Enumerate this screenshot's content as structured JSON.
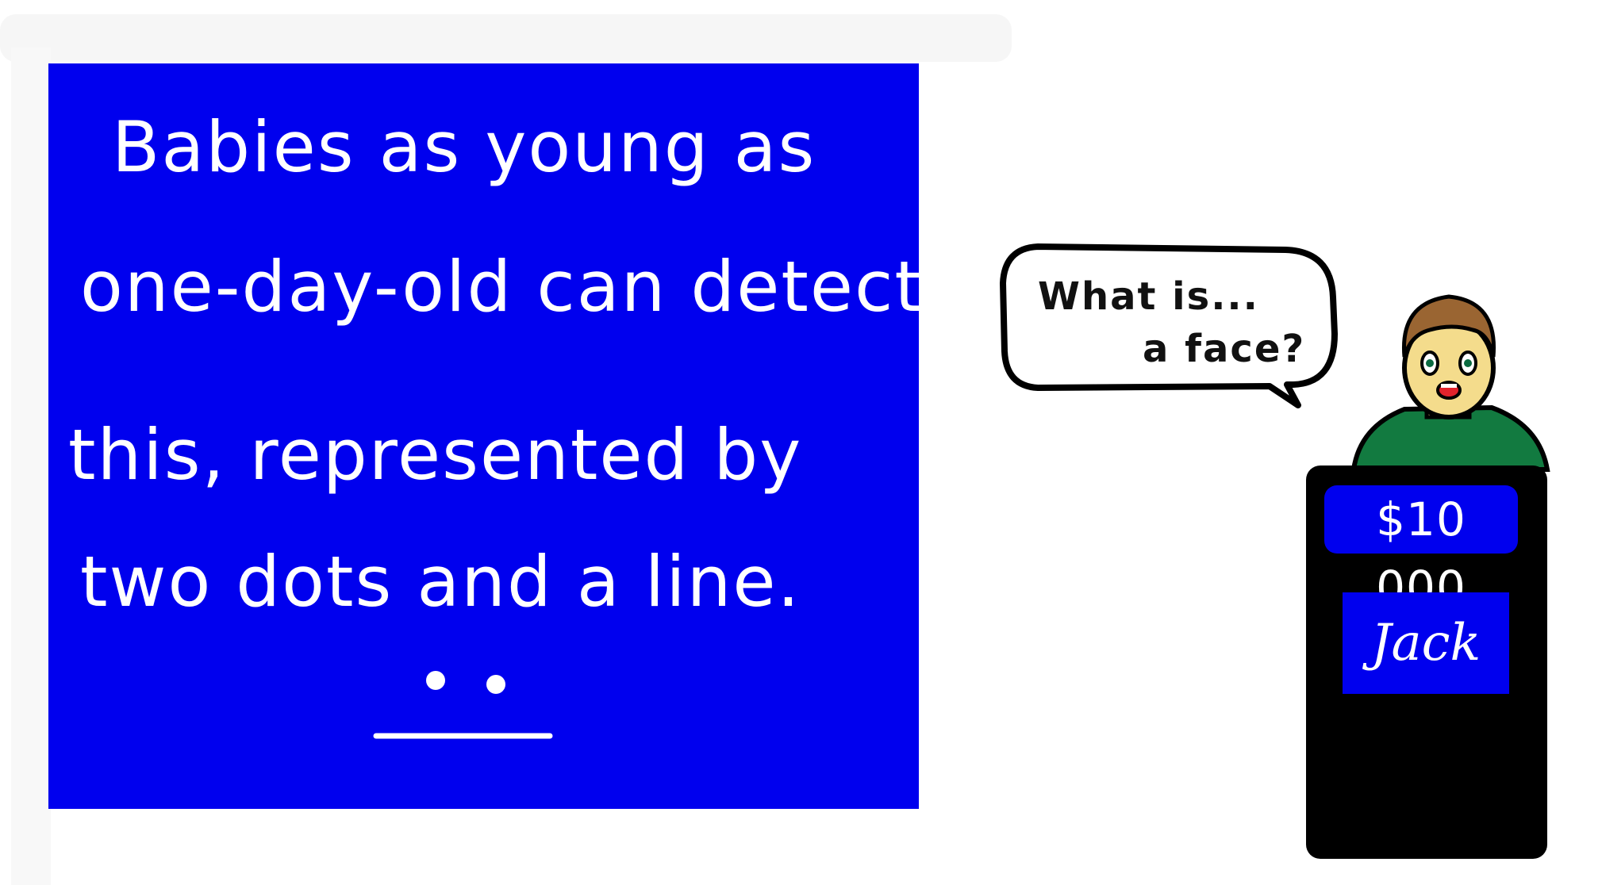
{
  "clue": {
    "lines": [
      "Babies as young as",
      "one-day-old can detect",
      "this, represented by",
      "two dots and a line."
    ],
    "board_color": "#0000ee"
  },
  "speech": {
    "line1": "What is...",
    "line2": "a face?"
  },
  "podium": {
    "score": "$10 000",
    "name": "Jack"
  }
}
